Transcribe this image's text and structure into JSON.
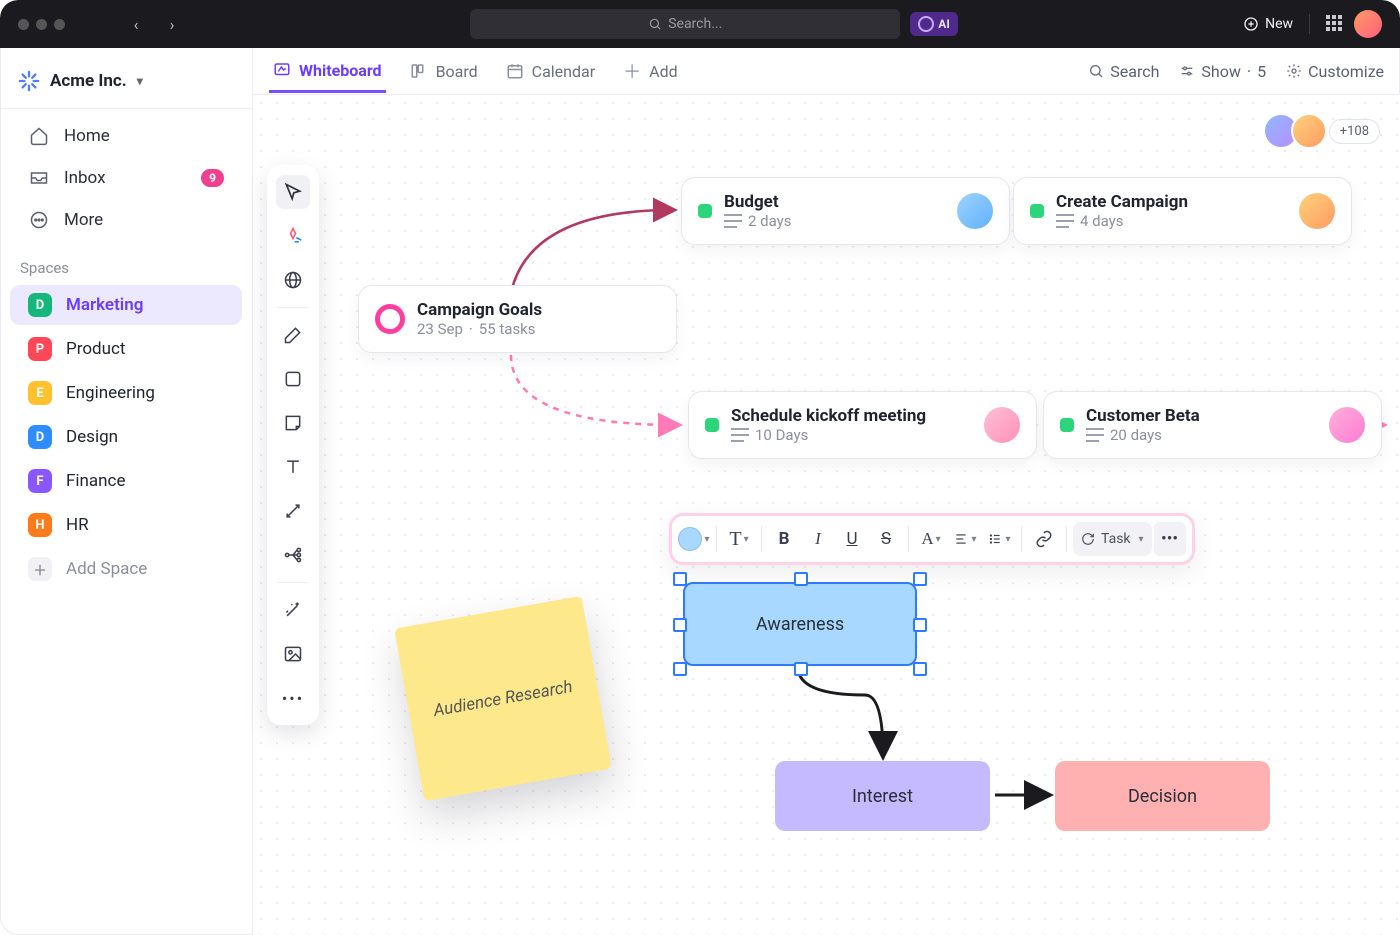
{
  "topbar": {
    "search_placeholder": "Search...",
    "ai_label": "AI",
    "new_label": "New"
  },
  "workspace": {
    "name": "Acme Inc."
  },
  "sidebar": {
    "nav": [
      {
        "label": "Home",
        "icon": "home-icon",
        "badge": null
      },
      {
        "label": "Inbox",
        "icon": "inbox-icon",
        "badge": "9"
      },
      {
        "label": "More",
        "icon": "more-icon",
        "badge": null
      }
    ],
    "spaces_label": "Spaces",
    "spaces": [
      {
        "letter": "D",
        "label": "Marketing",
        "color": "#15b87a",
        "active": true
      },
      {
        "letter": "P",
        "label": "Product",
        "color": "#ff4757",
        "active": false
      },
      {
        "letter": "E",
        "label": "Engineering",
        "color": "#ffc12e",
        "active": false
      },
      {
        "letter": "D",
        "label": "Design",
        "color": "#2f8cff",
        "active": false
      },
      {
        "letter": "F",
        "label": "Finance",
        "color": "#8a56ff",
        "active": false
      },
      {
        "letter": "H",
        "label": "HR",
        "color": "#ff7a1a",
        "active": false
      }
    ],
    "add_space": "Add Space"
  },
  "viewbar": {
    "tabs": [
      {
        "label": "Whiteboard",
        "icon": "whiteboard-icon",
        "active": true
      },
      {
        "label": "Board",
        "icon": "board-icon",
        "active": false
      },
      {
        "label": "Calendar",
        "icon": "calendar-icon",
        "active": false
      },
      {
        "label": "Add",
        "icon": "add-icon",
        "active": false
      }
    ],
    "search": "Search",
    "show": "Show",
    "show_count": "5",
    "customize": "Customize"
  },
  "collab": {
    "more": "+108",
    "avatars": [
      "a",
      "b"
    ]
  },
  "cards": {
    "goals": {
      "title": "Campaign Goals",
      "date": "23 Sep",
      "tasks": "55 tasks"
    },
    "budget": {
      "title": "Budget",
      "duration": "2 days"
    },
    "create": {
      "title": "Create Campaign",
      "duration": "4 days"
    },
    "kickoff": {
      "title": "Schedule kickoff meeting",
      "duration": "10 Days"
    },
    "beta": {
      "title": "Customer Beta",
      "duration": "20 days"
    }
  },
  "sticky": {
    "text": "Audience Research"
  },
  "flow": {
    "awareness": "Awareness",
    "interest": "Interest",
    "decision": "Decision"
  },
  "fmt": {
    "task": "Task"
  }
}
